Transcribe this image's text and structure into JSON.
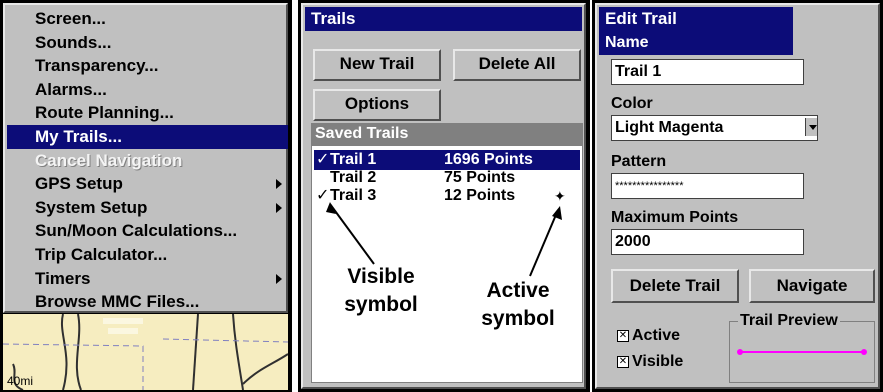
{
  "menu": {
    "items": [
      {
        "label": "Screen...",
        "state": "normal",
        "submenu": false
      },
      {
        "label": "Sounds...",
        "state": "normal",
        "submenu": false
      },
      {
        "label": "Transparency...",
        "state": "normal",
        "submenu": false
      },
      {
        "label": "Alarms...",
        "state": "normal",
        "submenu": false
      },
      {
        "label": "Route Planning...",
        "state": "normal",
        "submenu": false
      },
      {
        "label": "My Trails...",
        "state": "selected",
        "submenu": false
      },
      {
        "label": "Cancel Navigation",
        "state": "disabled",
        "submenu": false
      },
      {
        "label": "GPS Setup",
        "state": "normal",
        "submenu": true
      },
      {
        "label": "System Setup",
        "state": "normal",
        "submenu": true
      },
      {
        "label": "Sun/Moon Calculations...",
        "state": "normal",
        "submenu": false
      },
      {
        "label": "Trip Calculator...",
        "state": "normal",
        "submenu": false
      },
      {
        "label": "Timers",
        "state": "normal",
        "submenu": true
      },
      {
        "label": "Browse MMC Files...",
        "state": "normal",
        "submenu": false
      }
    ],
    "map_scale": "40mi"
  },
  "trails": {
    "title": "Trails",
    "new_trail": "New Trail",
    "delete_all": "Delete All",
    "options": "Options",
    "saved_title": "Saved Trails",
    "rows": [
      {
        "check": "✓",
        "name": "Trail 1",
        "points": "1696 Points"
      },
      {
        "check": "",
        "name": "Trail 2",
        "points": "75 Points"
      },
      {
        "check": "✓",
        "name": "Trail 3",
        "points": "12 Points"
      }
    ],
    "active_marker": "✦",
    "annotation_visible_1": "Visible",
    "annotation_visible_2": "symbol",
    "annotation_active_1": "Active",
    "annotation_active_2": "symbol"
  },
  "edit": {
    "title": "Edit Trail",
    "name_label": "Name",
    "name_value": "Trail 1",
    "color_label": "Color",
    "color_value": "Light Magenta",
    "pattern_label": "Pattern",
    "pattern_value": "****************",
    "max_label": "Maximum Points",
    "max_value": "2000",
    "delete_trail": "Delete Trail",
    "navigate": "Navigate",
    "active_label": "Active",
    "visible_label": "Visible",
    "check_mark": "✕",
    "preview_label": "Trail Preview",
    "preview_color": "#ff00ff"
  },
  "colors": {
    "selection": "#0c0c78",
    "panel": "#c0c0c0"
  }
}
